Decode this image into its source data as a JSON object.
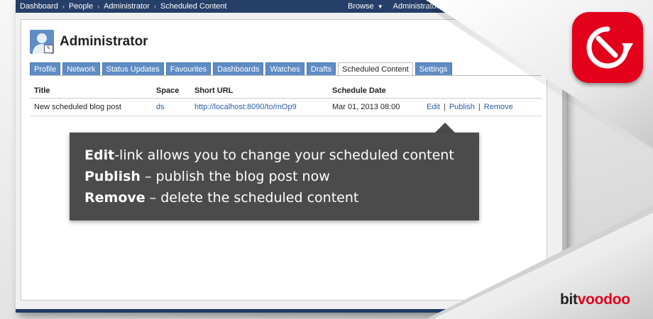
{
  "nav": {
    "breadcrumbs": [
      "Dashboard",
      "People",
      "Administrator",
      "Scheduled Content"
    ],
    "browse_label": "Browse",
    "user_label": "Administrator"
  },
  "profile": {
    "name": "Administrator"
  },
  "tabs": [
    {
      "label": "Profile",
      "active": false
    },
    {
      "label": "Network",
      "active": false
    },
    {
      "label": "Status Updates",
      "active": false
    },
    {
      "label": "Favourites",
      "active": false
    },
    {
      "label": "Dashboards",
      "active": false
    },
    {
      "label": "Watches",
      "active": false
    },
    {
      "label": "Drafts",
      "active": false
    },
    {
      "label": "Scheduled Content",
      "active": true
    },
    {
      "label": "Settings",
      "active": false
    }
  ],
  "table": {
    "columns": [
      "Title",
      "Space",
      "Short URL",
      "Schedule Date"
    ],
    "rows": [
      {
        "title": "New scheduled blog post",
        "space": "ds",
        "short_url": "http://localhost:8090/to/mOp9",
        "schedule_date": "Mar 01, 2013 08:00",
        "actions": [
          "Edit",
          "Publish",
          "Remove"
        ]
      }
    ]
  },
  "tooltip": {
    "line1_bold": "Edit",
    "line1_rest": "-link allows you to change your scheduled content",
    "line2_bold": "Publish",
    "line2_rest": " – publish the blog post now",
    "line3_bold": "Remove",
    "line3_rest": " – delete the scheduled content"
  },
  "brand": {
    "part1": "bit",
    "part2": "voodoo"
  },
  "colors": {
    "nav": "#263f68",
    "tab": "#5f8cc4",
    "link": "#2a5ea8",
    "tooltip": "#4b4b4b",
    "brand_red": "#e2001a"
  },
  "icons": [
    "user-avatar-icon",
    "scheduled-clock-icon",
    "chevron-right-icon",
    "caret-down-icon"
  ]
}
